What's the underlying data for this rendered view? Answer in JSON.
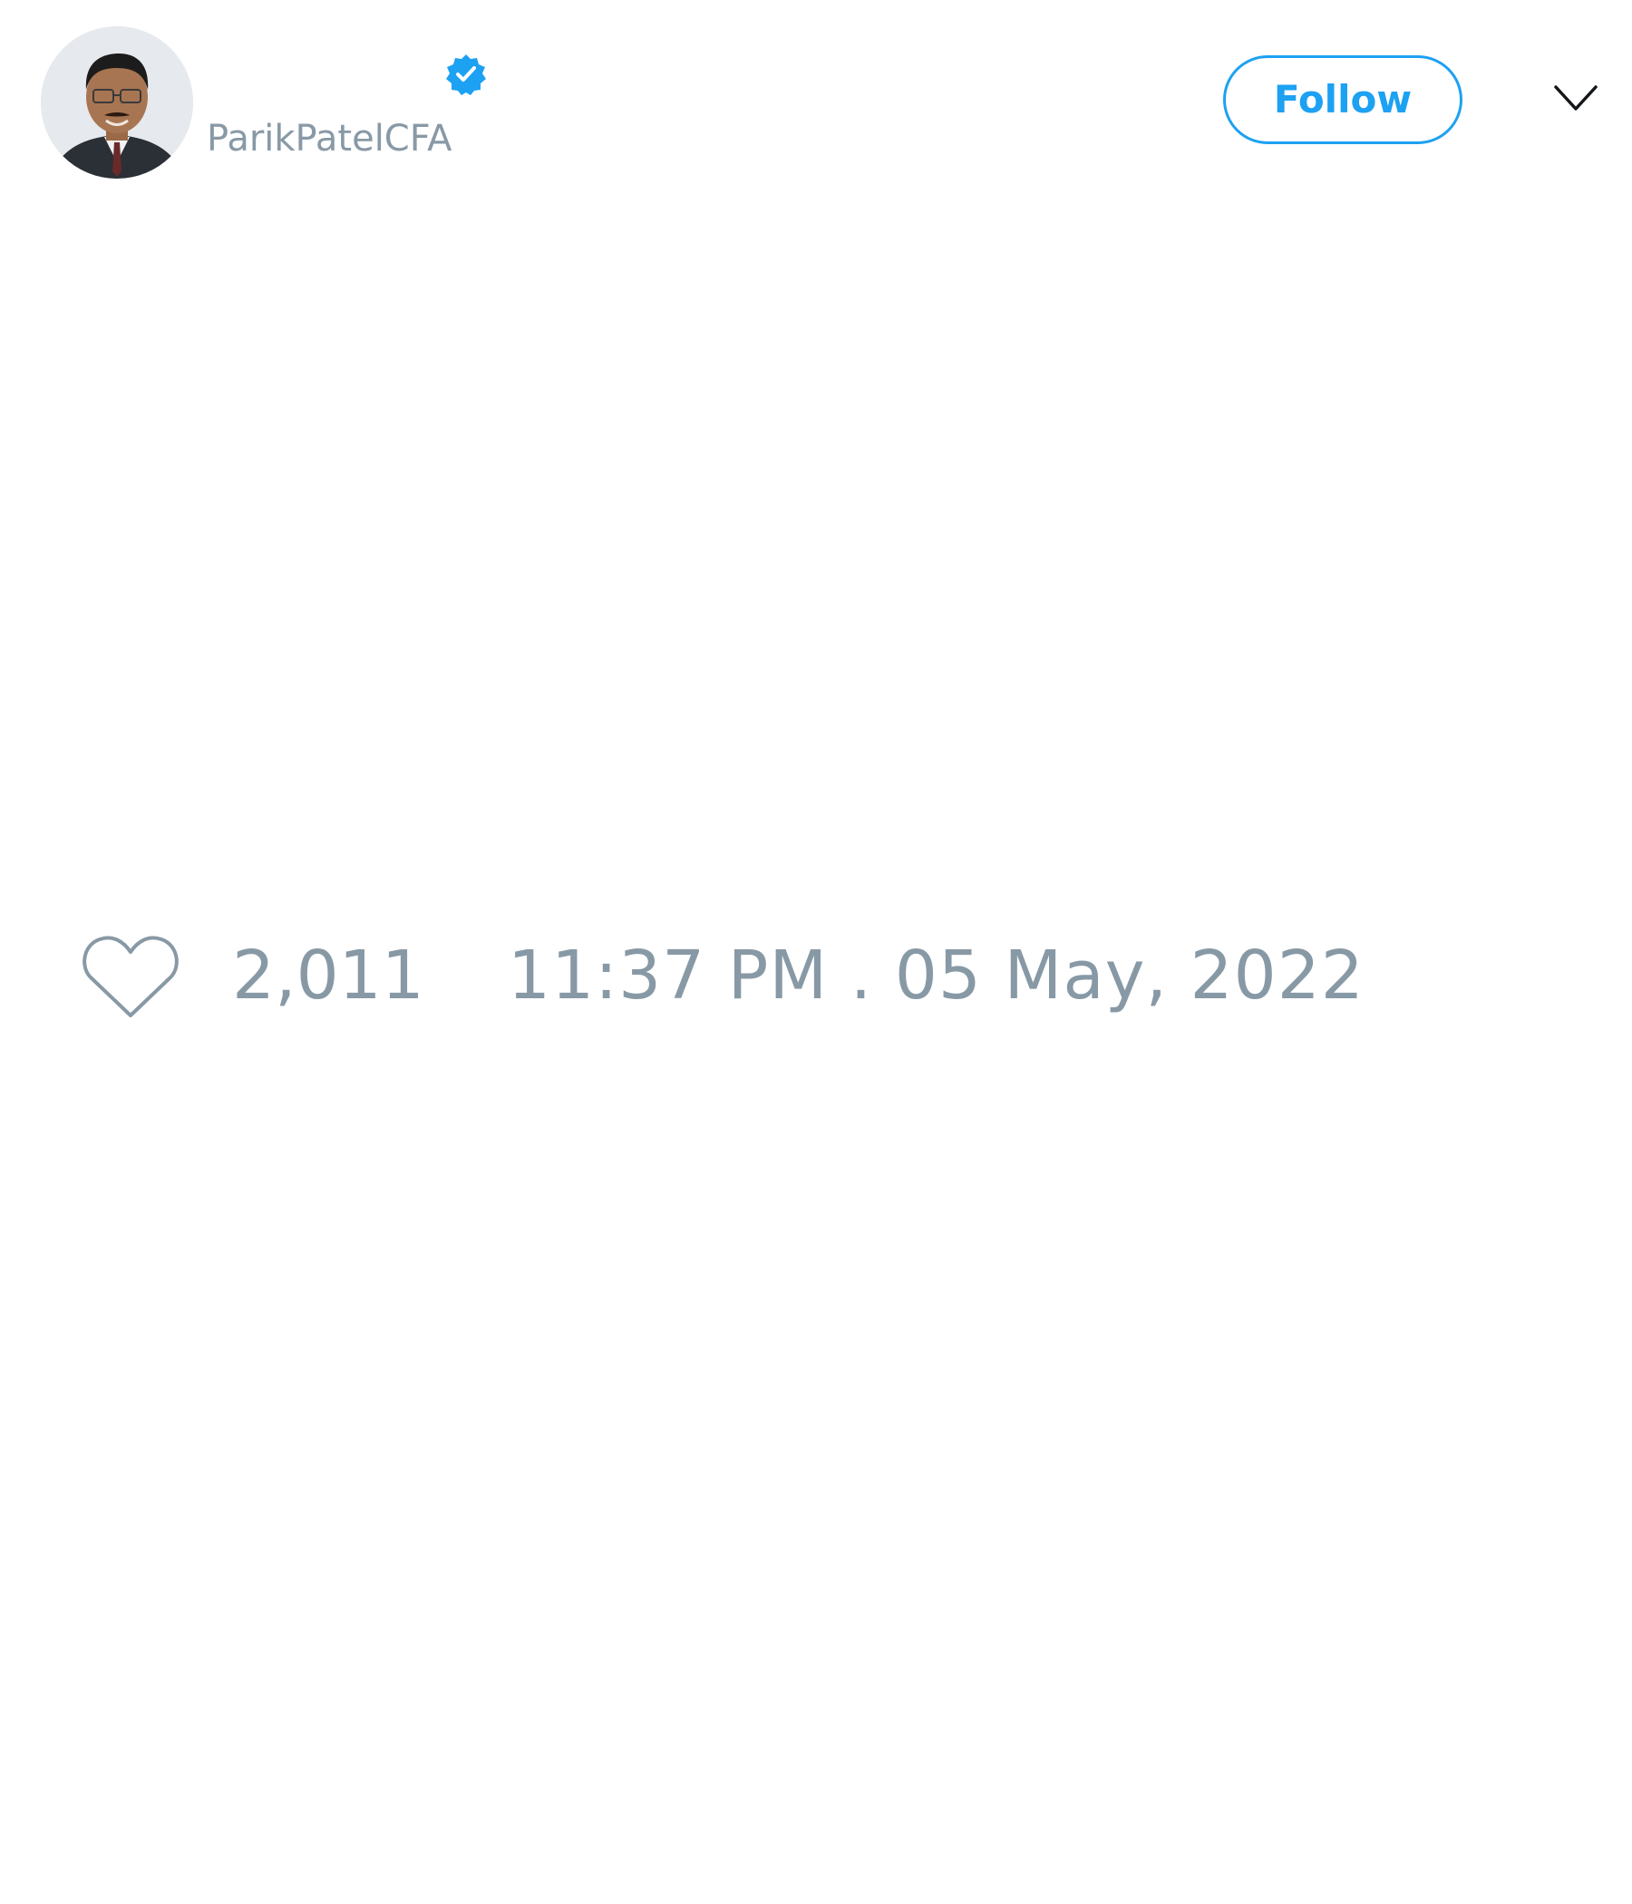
{
  "user": {
    "handle": "ParikPatelCFA",
    "verified": true,
    "avatar_icon": "person-portrait"
  },
  "actions": {
    "follow_label": "Follow",
    "menu_icon": "chevron-down-icon"
  },
  "stats": {
    "like_icon": "heart-outline-icon",
    "likes": "2,011",
    "timestamp": "11:37 PM . 05 May, 2022"
  },
  "colors": {
    "accent": "#1da1f2",
    "muted_text": "#8899a6",
    "background": "#ffffff"
  }
}
